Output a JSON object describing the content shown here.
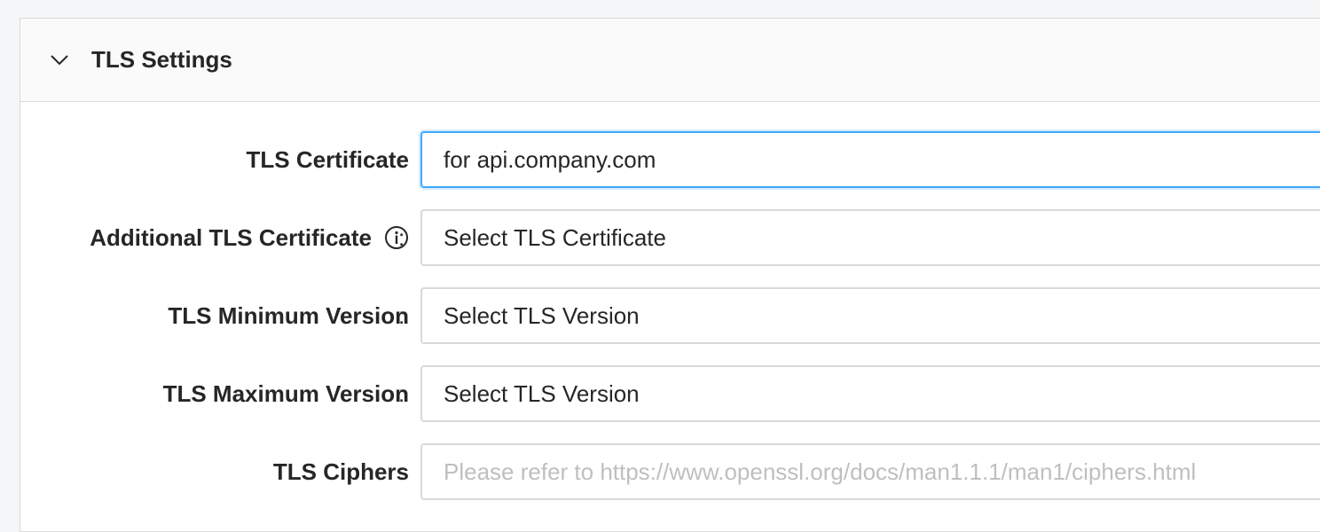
{
  "panel": {
    "title": "TLS Settings",
    "expand_icon": "chevron-down-icon"
  },
  "fields": {
    "tls_certificate": {
      "label": "TLS Certificate",
      "value": "for api.company.com"
    },
    "additional_tls_certificate": {
      "label": "Additional TLS Certificate",
      "info_icon": "info-circle-icon",
      "placeholder": "Select TLS Certificate"
    },
    "tls_minimum_version": {
      "label": "TLS Minimum Version",
      "placeholder": "Select TLS Version"
    },
    "tls_maximum_version": {
      "label": "TLS Maximum Version",
      "placeholder": "Select TLS Version"
    },
    "tls_ciphers": {
      "label": "TLS Ciphers",
      "placeholder": "Please refer to https://www.openssl.org/docs/man1.1.1/man1/ciphers.html"
    }
  },
  "colon": ":",
  "colors": {
    "focus_border": "#40a9ff",
    "border": "#d9d9d9",
    "placeholder": "#bfbfbf"
  }
}
